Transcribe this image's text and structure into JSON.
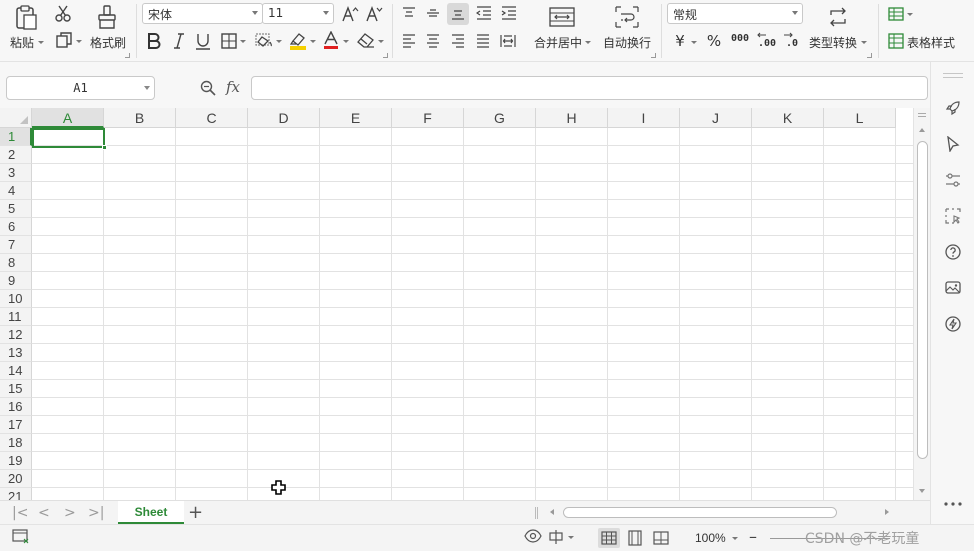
{
  "ribbon": {
    "clipboard": {
      "paste_label": "粘贴",
      "format_painter_label": "格式刷"
    },
    "font": {
      "font_name": "宋体",
      "font_size": "11"
    },
    "alignment": {
      "merge_center_label": "合并居中",
      "wrap_text_label": "自动换行"
    },
    "number": {
      "format": "常规",
      "currency_symbol": "¥",
      "percent_symbol": "%",
      "thousands_label": "000",
      "inc_decimal_label": ".00",
      "dec_decimal_label": ".0",
      "type_convert_label": "类型转换"
    },
    "styles": {
      "table_style_label": "表格样式"
    },
    "font_color": "#e02020",
    "highlight_color": "#f5d000"
  },
  "formula_bar": {
    "name_box": "A1",
    "fx_label": "fx",
    "formula": ""
  },
  "grid": {
    "columns": [
      "A",
      "B",
      "C",
      "D",
      "E",
      "F",
      "G",
      "H",
      "I",
      "J",
      "K",
      "L"
    ],
    "rows": [
      "1",
      "2",
      "3",
      "4",
      "5",
      "6",
      "7",
      "8",
      "9",
      "10",
      "11",
      "12",
      "13",
      "14",
      "15",
      "16",
      "17",
      "18",
      "19",
      "20",
      "21"
    ],
    "active_cell": "A1"
  },
  "sheet_tabs": {
    "tabs": [
      "Sheet"
    ],
    "active": "Sheet",
    "add_label": "+"
  },
  "status_bar": {
    "zoom": "100%",
    "zoom_minus": "–",
    "watermark": "CSDN @不老玩童"
  },
  "side_panel": {
    "icons": [
      "rocket-icon",
      "cursor-arrow-icon",
      "sliders-icon",
      "selection-icon",
      "help-icon",
      "image-icon",
      "lightning-icon",
      "more-icon"
    ]
  },
  "accent_color": "#2e8a38"
}
